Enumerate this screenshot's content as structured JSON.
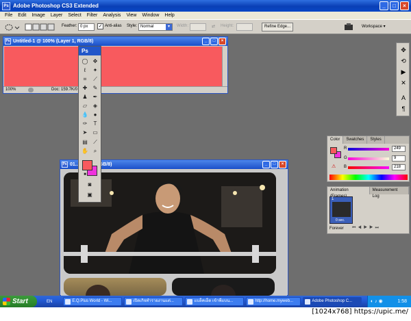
{
  "app": {
    "title": "Adobe Photoshop CS3 Extended",
    "logo": "Ps"
  },
  "menu": [
    "File",
    "Edit",
    "Image",
    "Layer",
    "Select",
    "Filter",
    "Analysis",
    "View",
    "Window",
    "Help"
  ],
  "options": {
    "feather_label": "Feather:",
    "feather_value": "0 px",
    "antialias_label": "Anti-alias",
    "antialias_checked": true,
    "style_label": "Style:",
    "style_value": "Normal",
    "width_label": "Width:",
    "height_label": "Height:",
    "refine_edge": "Refine Edge...",
    "workspace": "Workspace ▾"
  },
  "doc1": {
    "title": "Untitled-1 @ 100% (Layer 1, RGB/8)",
    "zoom": "100%",
    "doc_info": "Doc: 159.7K/0 bytes",
    "fill_color": "#f85a5e"
  },
  "doc2": {
    "title": "01... 100% (RGB/8)"
  },
  "toolbox": {
    "header": "Ps",
    "foreground_color": "#f85a5e",
    "background_color": "#ee33dd"
  },
  "color_panel": {
    "tabs": [
      "Color",
      "Swatches",
      "Styles"
    ],
    "r_label": "R",
    "g_label": "G",
    "b_label": "B",
    "r_value": "249",
    "g_value": "9",
    "b_value": "218"
  },
  "anim_panel": {
    "tabs": [
      "Animation (Frames)",
      "Measurement Log"
    ],
    "frame_number": "1",
    "frame_delay": "0 sec.",
    "loop": "Forever"
  },
  "taskbar": {
    "start": "Start",
    "lang": "EN",
    "tasks": [
      "E.Q.Plus World - Wi...",
      "เปิดเกิจทำรายงานแต่...",
      "แบล็คเอ็ด เข้าพี่แบน...",
      "http://home.myweb...",
      "Adobe Photoshop C..."
    ],
    "clock": "1:58"
  },
  "watermark": "[1024x768] https://upic.me/"
}
